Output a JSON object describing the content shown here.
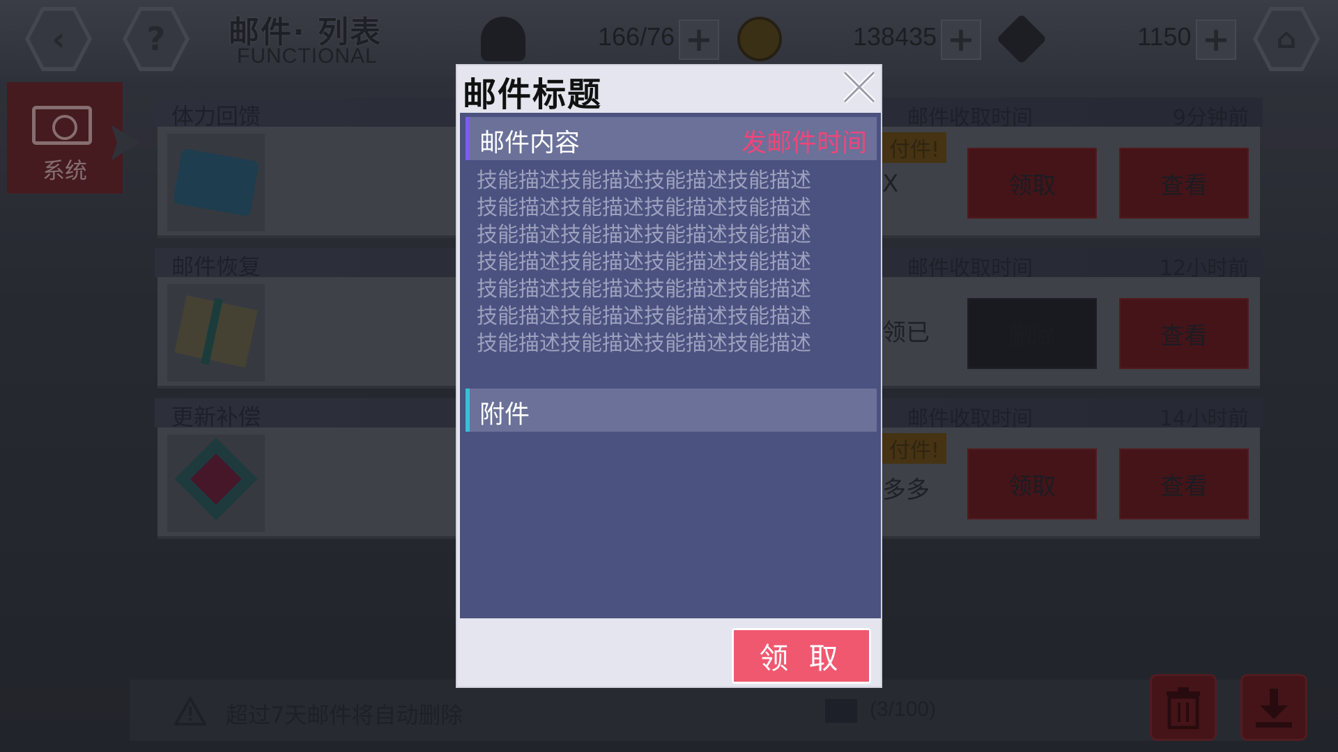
{
  "header": {
    "title_cn": "邮件· 列表",
    "title_en": "FUNCTIONAL",
    "stamina": "166/76",
    "coins": "138435",
    "gems": "1150"
  },
  "sidebar": {
    "tab_label": "系统"
  },
  "mails": [
    {
      "title": "体力回馈",
      "recv_label": "邮件收取时间",
      "time": "9分钟前",
      "peek": "付件!",
      "peek2": "X",
      "action1": "领取",
      "action2": "查看",
      "icon": "vs-ticket-icon"
    },
    {
      "title": "邮件恢复",
      "recv_label": "邮件收取时间",
      "time": "12小时前",
      "peek": "",
      "peek2": "领已",
      "action1": "删除",
      "action2": "查看",
      "icon": "letter-ribbon-icon"
    },
    {
      "title": "更新补偿",
      "recv_label": "邮件收取时间",
      "time": "14小时前",
      "peek": "付件!",
      "peek2": "多多",
      "action1": "领取",
      "action2": "查看",
      "icon": "heart-crest-icon"
    }
  ],
  "footer": {
    "notice": "超过7天邮件将自动删除",
    "mail_count": "(3/100)"
  },
  "dialog": {
    "title": "邮件标题",
    "content_header": "邮件内容",
    "send_time": "发邮件时间",
    "content_lines": [
      "技能描述技能描述技能描述技能描述",
      "技能描述技能描述技能描述技能描述",
      "技能描述技能描述技能描述技能描述",
      "技能描述技能描述技能描述技能描述",
      "技能描述技能描述技能描述技能描述",
      "技能描述技能描述技能描述技能描述",
      "技能描述技能描述技能描述技能描述"
    ],
    "attachment_header": "附件",
    "claim_button": "领 取"
  },
  "colors": {
    "accent_pink": "#f0586f",
    "time_red": "#f0457a",
    "panel_blue": "#4b5280"
  }
}
